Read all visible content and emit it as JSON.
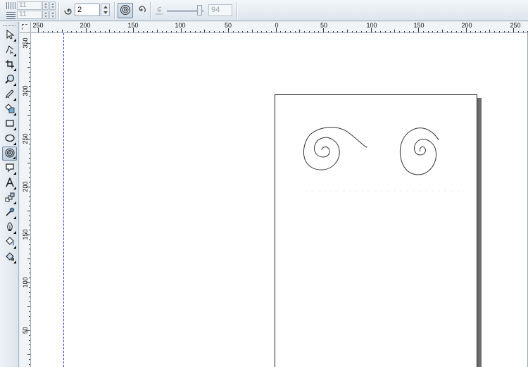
{
  "property_bar": {
    "grid_columns_value": "11",
    "grid_rows_value": "11",
    "spiral_revolutions": "2",
    "expansion_value": "94",
    "icons": {
      "grid_columns": "grid-columns-icon",
      "grid_rows": "grid-rows-icon",
      "revolutions": "spiral-revolutions-icon",
      "symmetric": "symmetric-spiral-icon",
      "logarithmic": "logarithmic-spiral-icon",
      "expansion": "spiral-expansion-icon"
    }
  },
  "toolbox": {
    "tools": [
      {
        "name": "pick-tool",
        "icon": "arrow-icon"
      },
      {
        "name": "shape-tool",
        "icon": "shape-edit-icon"
      },
      {
        "name": "crop-tool",
        "icon": "crop-icon"
      },
      {
        "name": "zoom-tool",
        "icon": "magnifier-icon"
      },
      {
        "name": "freehand-tool",
        "icon": "pen-icon"
      },
      {
        "name": "smart-fill-tool",
        "icon": "smart-fill-icon"
      },
      {
        "name": "rectangle-tool",
        "icon": "rectangle-icon"
      },
      {
        "name": "ellipse-tool",
        "icon": "ellipse-icon"
      },
      {
        "name": "spiral-tool",
        "icon": "spiral-icon",
        "active": true
      },
      {
        "name": "basic-shapes-tool",
        "icon": "basic-shapes-icon"
      },
      {
        "name": "text-tool",
        "icon": "text-a-icon"
      },
      {
        "name": "interactive-blend-tool",
        "icon": "blend-icon"
      },
      {
        "name": "eyedropper-tool",
        "icon": "eyedropper-icon"
      },
      {
        "name": "outline-tool",
        "icon": "pen-nib-icon"
      },
      {
        "name": "fill-tool",
        "icon": "paint-bucket-icon"
      },
      {
        "name": "interactive-fill-tool",
        "icon": "interactive-fill-icon"
      }
    ]
  },
  "rulers": {
    "horizontal_labels": [
      "250",
      "200",
      "150",
      "100",
      "50",
      "0",
      "50",
      "100",
      "150",
      "200",
      "250"
    ],
    "vertical_labels": [
      "350",
      "300",
      "250",
      "200",
      "150",
      "100",
      "50"
    ]
  },
  "colors": {
    "guide": "#3344cc",
    "page_shadow": "#6d6d6d",
    "active_tool_border": "#6d87a3"
  }
}
